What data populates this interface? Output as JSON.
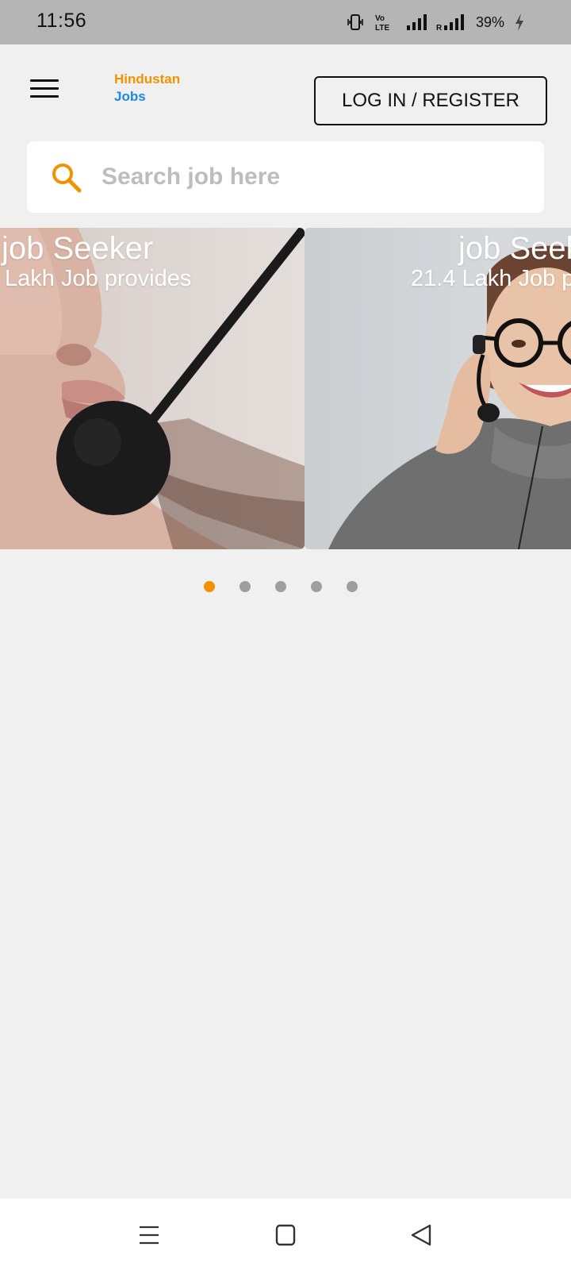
{
  "status_bar": {
    "time": "11:56",
    "battery": "39%",
    "volte_label": "Vo LTE",
    "roaming_label": "R",
    "icons": [
      "vibrate-icon",
      "volte-icon",
      "signal-icon",
      "signal-roaming-icon",
      "charging-icon"
    ]
  },
  "header": {
    "menu_icon": "hamburger-menu-icon",
    "brand_line1": "Hindustan",
    "brand_line2": "Jobs",
    "login_label": "LOG IN / REGISTER"
  },
  "search": {
    "placeholder": "Search job here",
    "icon": "search-icon"
  },
  "carousel": {
    "slides": [
      {
        "title": "job Seeker",
        "subtitle": "Lakh Job provides"
      },
      {
        "title": "job Seek",
        "subtitle": "21.4 Lakh Job p"
      }
    ],
    "dot_count": 5,
    "active_index": 0
  },
  "nav_bar": {
    "icons": [
      "recent-apps-icon",
      "home-icon",
      "back-icon"
    ]
  },
  "colors": {
    "accent_orange": "#f39200",
    "brand_blue": "#1e88e5",
    "background": "#f0f0f0",
    "status_bar": "#b5b5b5"
  }
}
